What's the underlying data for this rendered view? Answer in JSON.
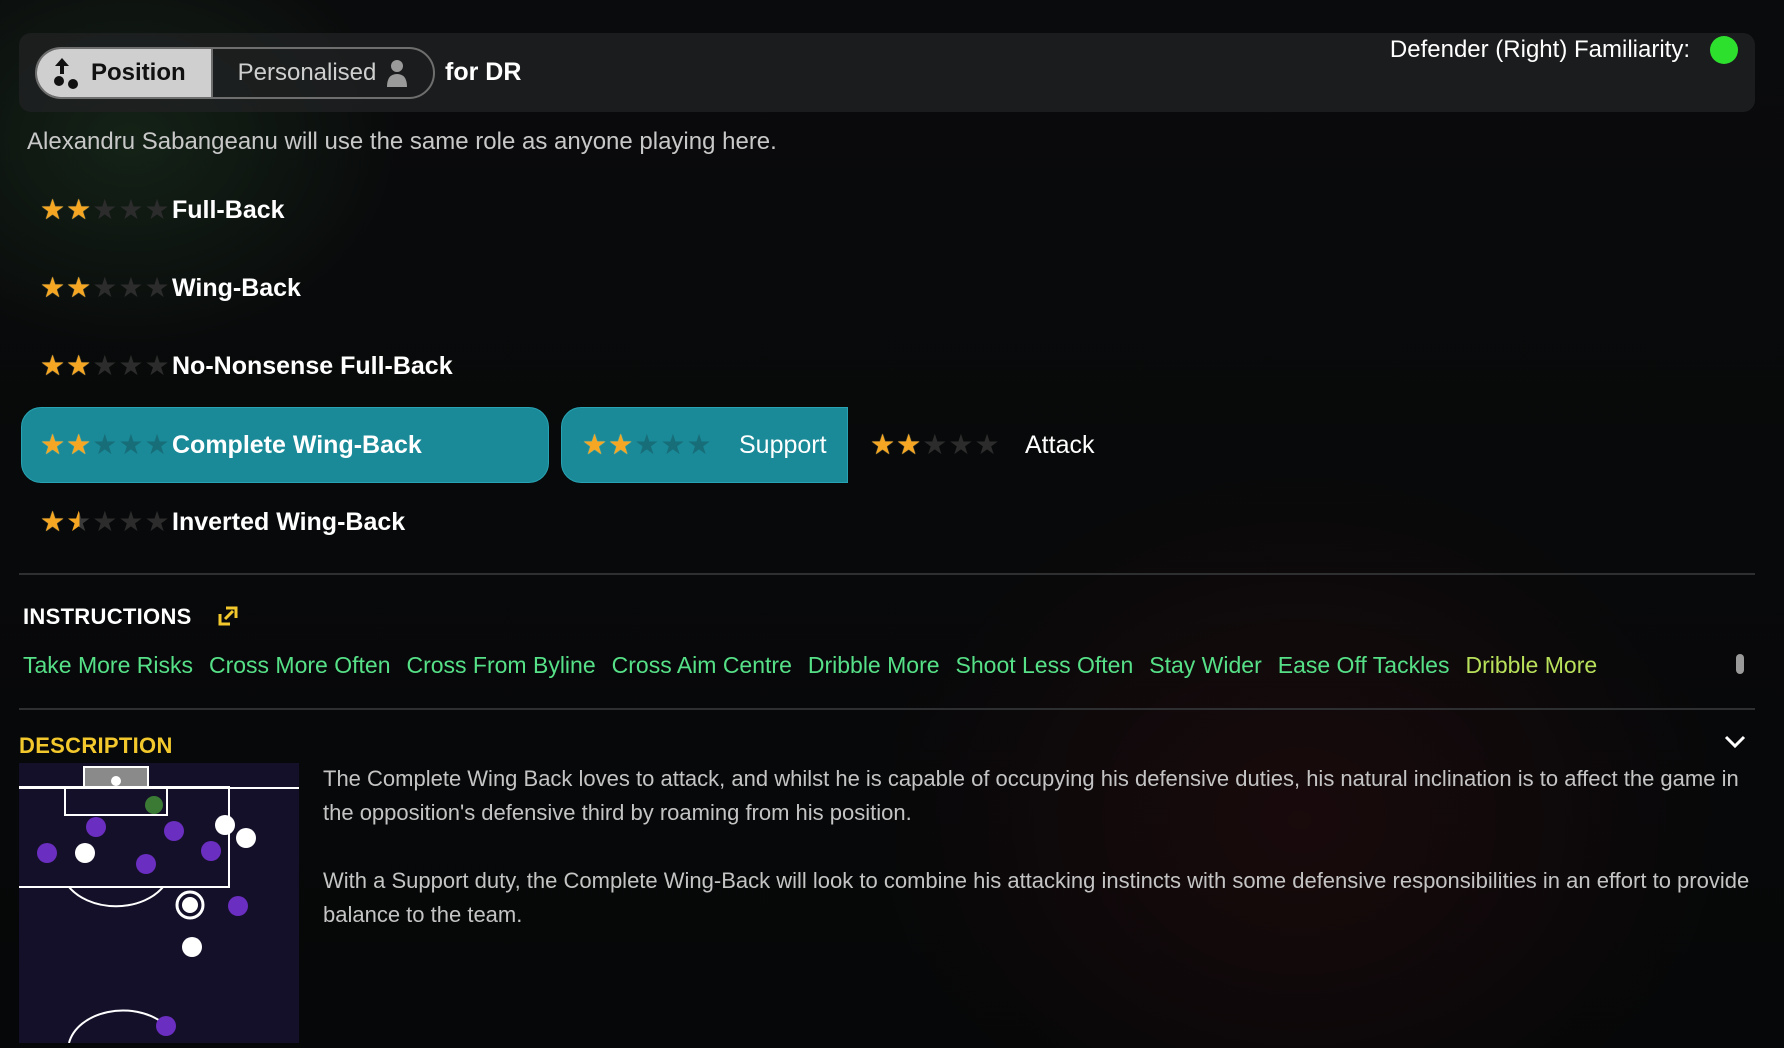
{
  "header": {
    "toggle_position": "Position",
    "toggle_personalised": "Personalised",
    "for_position": "for DR",
    "familiarity_label": "Defender (Right) Familiarity:",
    "familiarity_color": "#2ee02e"
  },
  "subtitle": "Alexandru Sabangeanu will use the same role as anyone playing here.",
  "roles": [
    {
      "name": "Full-Back",
      "rating": 2
    },
    {
      "name": "Wing-Back",
      "rating": 2
    },
    {
      "name": "No-Nonsense Full-Back",
      "rating": 2
    },
    {
      "name": "Complete Wing-Back",
      "rating": 5,
      "filled": 2,
      "selected": true
    },
    {
      "name": "Inverted Wing-Back",
      "rating": 1.5
    }
  ],
  "duties": [
    {
      "label": "Support",
      "rating": 5,
      "filled": 2,
      "selected": true
    },
    {
      "label": "Attack",
      "rating": 2,
      "selected": false
    }
  ],
  "instructions": {
    "title": "INSTRUCTIONS",
    "items": [
      "Take More Risks",
      "Cross More Often",
      "Cross From Byline",
      "Cross Aim Centre",
      "Dribble More",
      "Shoot Less Often",
      "Stay Wider",
      "Ease Off Tackles",
      "Dribble More"
    ]
  },
  "description": {
    "title": "DESCRIPTION",
    "paragraphs": [
      "The Complete Wing Back loves to attack, and whilst he is capable of occupying his defensive duties, his natural inclination is to affect the game in the opposition's defensive third by roaming from his position.",
      "With a Support duty, the Complete Wing-Back will look to combine his attacking instincts with some defensive responsibilities in an effort to provide balance to the team."
    ]
  },
  "colors": {
    "accent_teal": "#1a8a98",
    "instruction_green": "#56e087",
    "section_yellow": "#f2c82c"
  }
}
